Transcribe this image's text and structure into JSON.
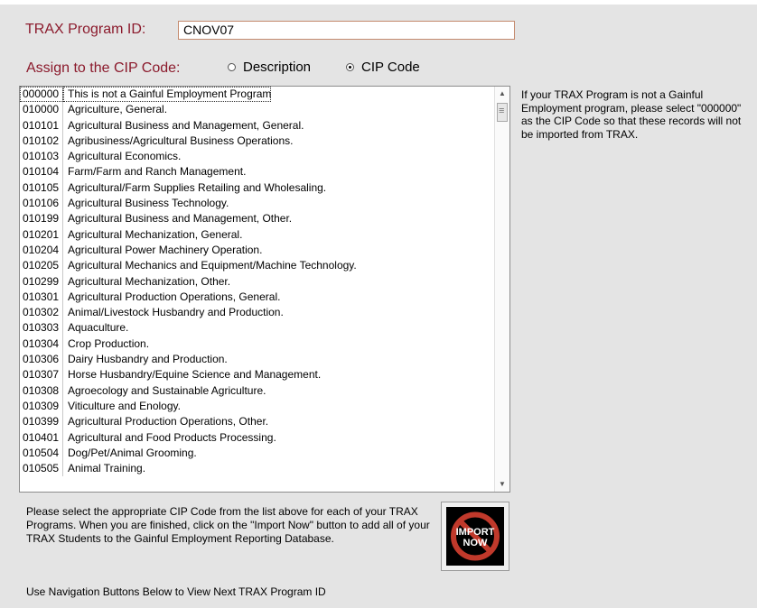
{
  "form": {
    "program_id_label": "TRAX Program ID:",
    "program_id_value": "CNOV07",
    "assign_label": "Assign to the CIP Code:",
    "radio_description": "Description",
    "radio_cip_code": "CIP Code",
    "selected_radio": "CIP Code"
  },
  "cip_list": [
    {
      "code": "000000",
      "desc": "This is not a Gainful Employment Program"
    },
    {
      "code": "010000",
      "desc": "Agriculture, General."
    },
    {
      "code": "010101",
      "desc": "Agricultural Business and Management, General."
    },
    {
      "code": "010102",
      "desc": "Agribusiness/Agricultural Business Operations."
    },
    {
      "code": "010103",
      "desc": "Agricultural Economics."
    },
    {
      "code": "010104",
      "desc": "Farm/Farm and Ranch Management."
    },
    {
      "code": "010105",
      "desc": "Agricultural/Farm Supplies Retailing and Wholesaling."
    },
    {
      "code": "010106",
      "desc": "Agricultural Business Technology."
    },
    {
      "code": "010199",
      "desc": "Agricultural Business and Management, Other."
    },
    {
      "code": "010201",
      "desc": "Agricultural Mechanization, General."
    },
    {
      "code": "010204",
      "desc": "Agricultural Power Machinery Operation."
    },
    {
      "code": "010205",
      "desc": "Agricultural Mechanics and Equipment/Machine Technology."
    },
    {
      "code": "010299",
      "desc": "Agricultural Mechanization, Other."
    },
    {
      "code": "010301",
      "desc": "Agricultural Production Operations, General."
    },
    {
      "code": "010302",
      "desc": "Animal/Livestock Husbandry and Production."
    },
    {
      "code": "010303",
      "desc": "Aquaculture."
    },
    {
      "code": "010304",
      "desc": "Crop Production."
    },
    {
      "code": "010306",
      "desc": "Dairy Husbandry and Production."
    },
    {
      "code": "010307",
      "desc": "Horse Husbandry/Equine Science and Management."
    },
    {
      "code": "010308",
      "desc": "Agroecology and Sustainable Agriculture."
    },
    {
      "code": "010309",
      "desc": "Viticulture and Enology."
    },
    {
      "code": "010399",
      "desc": "Agricultural Production Operations, Other."
    },
    {
      "code": "010401",
      "desc": "Agricultural and Food Products Processing."
    },
    {
      "code": "010504",
      "desc": "Dog/Pet/Animal Grooming."
    },
    {
      "code": "010505",
      "desc": "Animal Training."
    }
  ],
  "side_note": "If your TRAX Program is not a Gainful Employment program, please select \"000000\" as the CIP Code so that these records will not be imported from TRAX.",
  "instructions": "Please select the appropriate CIP Code from the list above for each of your TRAX Programs. When you are finished, click on the \"Import Now\" button to add all of your TRAX Students to the Gainful Employment Reporting Database.",
  "import_button": {
    "label": "IMPORT NOW",
    "icon": "no-symbol-icon",
    "accent": "#c0392b"
  },
  "footer_note": "Use Navigation Buttons Below to View Next TRAX Program ID"
}
